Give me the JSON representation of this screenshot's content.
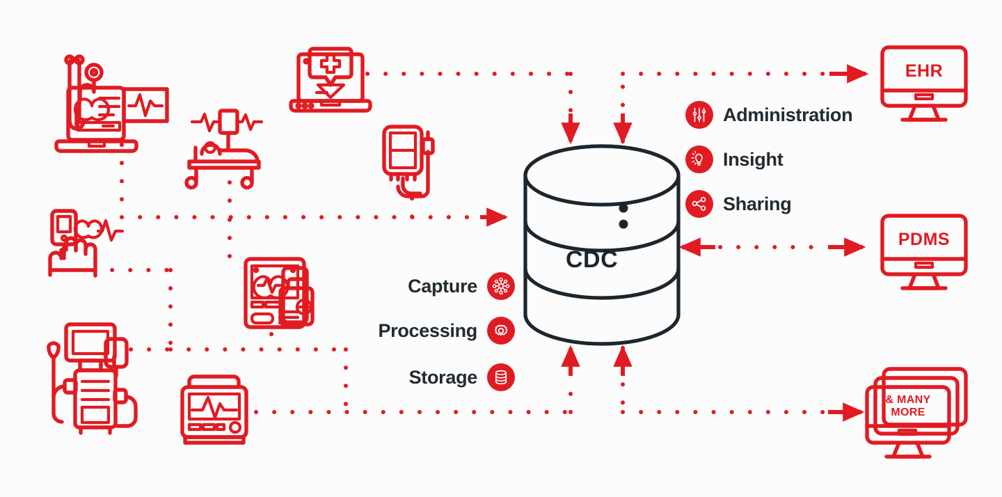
{
  "diagram": {
    "title_center": "CDC",
    "accent_color": "#e11b22",
    "dark_color": "#1d262c",
    "background_color": "#fcfcfc"
  },
  "core": {
    "label": "CDC",
    "shape": "database-cylinder"
  },
  "pipeline_labels": [
    {
      "label": "Capture",
      "icon": "network-nodes-icon"
    },
    {
      "label": "Processing",
      "icon": "gear-icon"
    },
    {
      "label": "Storage",
      "icon": "database-icon"
    }
  ],
  "output_labels": [
    {
      "label": "Administration",
      "icon": "sliders-icon"
    },
    {
      "label": "Insight",
      "icon": "lightbulb-icon"
    },
    {
      "label": "Sharing",
      "icon": "share-nodes-icon"
    }
  ],
  "destinations": [
    {
      "label": "EHR",
      "icon": "monitor-icon",
      "connector": "one-way"
    },
    {
      "label": "PDMS",
      "icon": "monitor-icon",
      "connector": "two-way"
    },
    {
      "label": "& MANY\nMORE",
      "label_line1": "& MANY",
      "label_line2": "MORE",
      "icon": "stacked-monitors-icon",
      "connector": "one-way"
    }
  ],
  "sources": [
    {
      "name": "laptop-stethoscope-ecg",
      "icon": "laptop-health-record-icon"
    },
    {
      "name": "patient-bed-monitor",
      "icon": "hospital-bed-ecg-icon"
    },
    {
      "name": "laptop-medical-cross",
      "icon": "laptop-medical-cross-icon"
    },
    {
      "name": "infusion-iv-pump",
      "icon": "iv-infusion-bag-icon"
    },
    {
      "name": "handheld-vitals-device",
      "icon": "hand-mobile-heartbeat-icon"
    },
    {
      "name": "tablet-health-chart",
      "icon": "tablet-heart-medkit-icon"
    },
    {
      "name": "dialysis-machine",
      "icon": "dialysis-machine-icon"
    },
    {
      "name": "vital-signs-monitor",
      "icon": "ecg-monitor-icon"
    }
  ]
}
